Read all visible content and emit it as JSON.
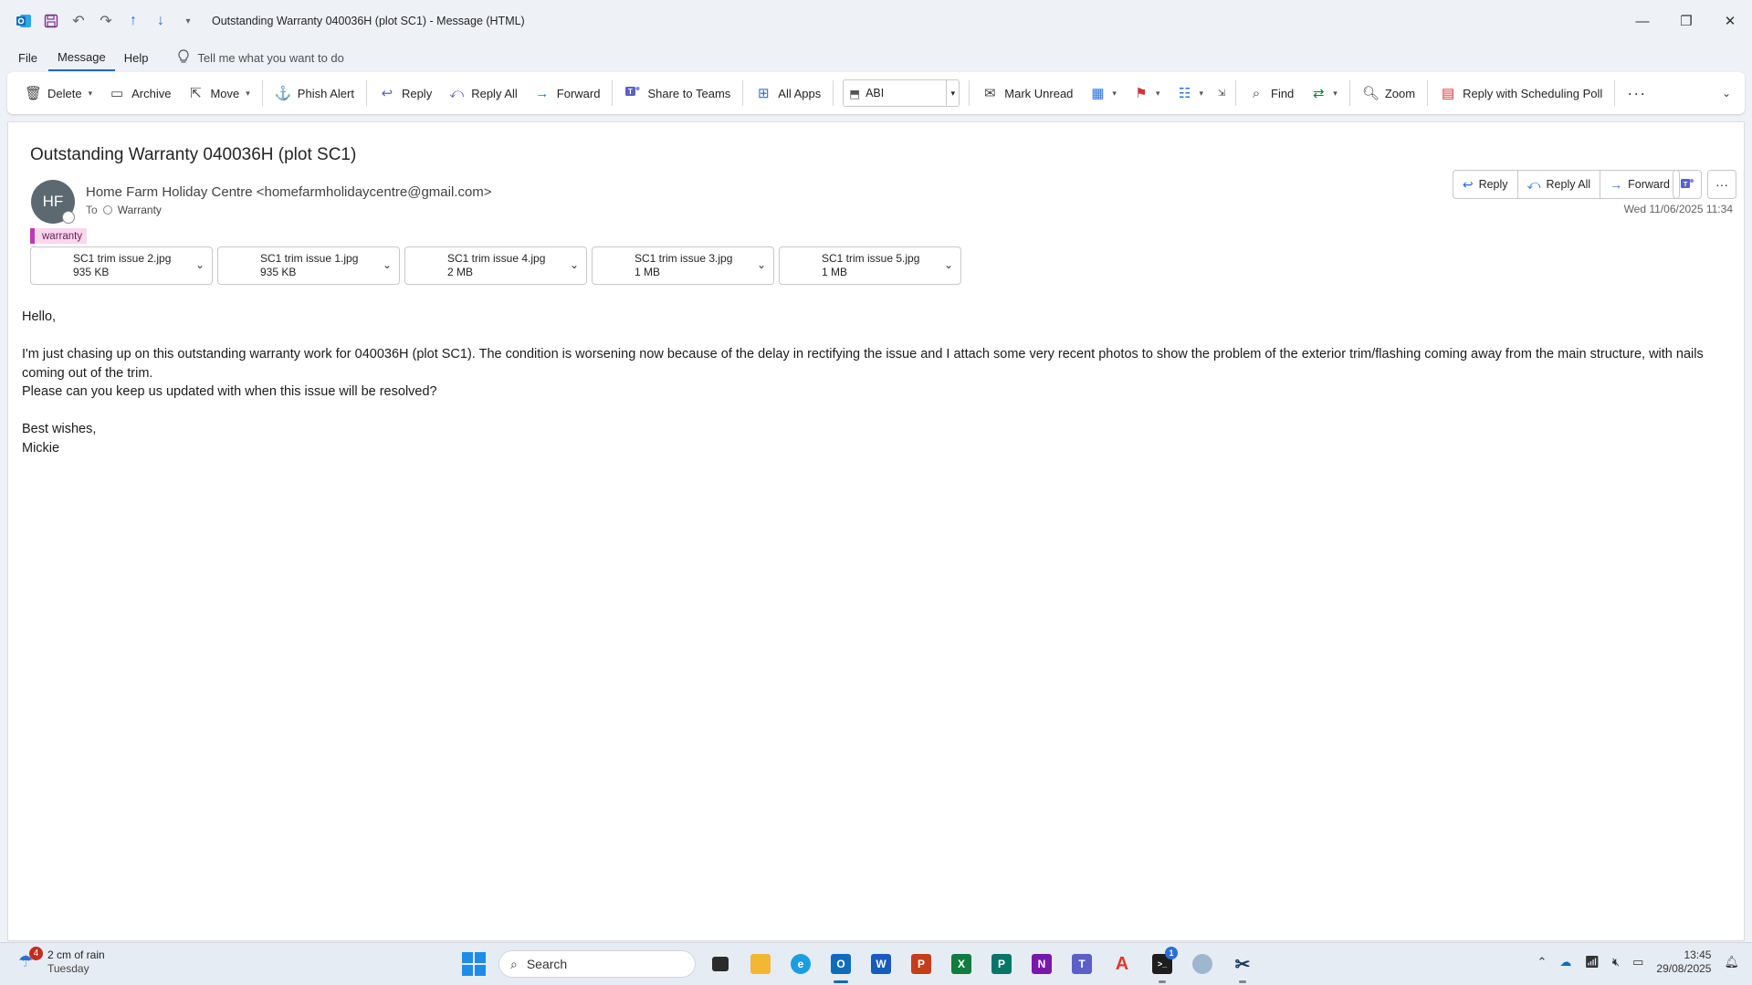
{
  "window": {
    "title": "Outstanding Warranty 040036H (plot SC1)  -  Message (HTML)",
    "controls": {
      "minimize": "—",
      "restore": "❐",
      "close": "✕"
    }
  },
  "menu": {
    "file": "File",
    "message": "Message",
    "help": "Help",
    "tell_me": "Tell me what you want to do"
  },
  "ribbon": {
    "delete": "Delete",
    "archive": "Archive",
    "move": "Move",
    "phish_alert": "Phish Alert",
    "reply": "Reply",
    "reply_all": "Reply All",
    "forward": "Forward",
    "share_to_teams": "Share to Teams",
    "all_apps": "All Apps",
    "quick_step": "ABI",
    "mark_unread": "Mark Unread",
    "find": "Find",
    "zoom": "Zoom",
    "reply_scheduling_poll": "Reply with Scheduling Poll"
  },
  "message": {
    "subject": "Outstanding Warranty 040036H (plot SC1)",
    "avatar_initials": "HF",
    "sender": "Home Farm Holiday Centre <homefarmholidaycentre@gmail.com>",
    "to_label": "To",
    "recipient": "Warranty",
    "category": "warranty",
    "date": "Wed 11/06/2025 11:34",
    "actions": {
      "reply": "Reply",
      "reply_all": "Reply All",
      "forward": "Forward"
    },
    "attachments": [
      {
        "name": "SC1 trim issue 2.jpg",
        "size": "935 KB"
      },
      {
        "name": "SC1 trim issue 1.jpg",
        "size": "935 KB"
      },
      {
        "name": "SC1 trim issue 4.jpg",
        "size": "2 MB"
      },
      {
        "name": "SC1 trim issue 3.jpg",
        "size": "1 MB"
      },
      {
        "name": "SC1 trim issue 5.jpg",
        "size": "1 MB"
      }
    ],
    "body": {
      "greeting": "Hello,",
      "para1": "I'm just chasing up on this outstanding warranty work for 040036H (plot SC1). The condition is worsening now because of the delay in rectifying the issue and I attach some very recent photos to show the problem of the exterior trim/flashing coming away from the main structure, with nails coming out of the trim.",
      "para2": "Please can you keep us updated with when this issue will be resolved?",
      "signoff": "Best wishes,",
      "name": "Mickie"
    }
  },
  "taskbar": {
    "weather_text": "2 cm of rain",
    "weather_day": "Tuesday",
    "weather_badge": "4",
    "search_placeholder": "Search",
    "teams_badge": "1",
    "time": "13:45",
    "date": "29/08/2025"
  },
  "colors": {
    "accent": "#0f6cbd",
    "category_bar": "#c239b3",
    "category_fill": "#f8d7ec",
    "avatar": "#5c6970"
  }
}
